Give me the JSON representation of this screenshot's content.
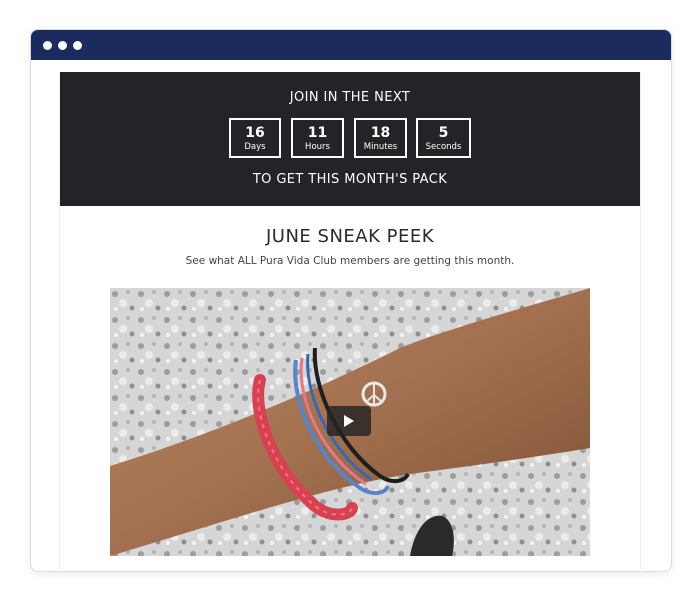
{
  "countdown": {
    "heading": "JOIN IN THE NEXT",
    "units": [
      {
        "value": "16",
        "label": "Days"
      },
      {
        "value": "11",
        "label": "Hours"
      },
      {
        "value": "18",
        "label": "Minutes"
      },
      {
        "value": "5",
        "label": "Seconds"
      }
    ],
    "footer": "TO GET THIS MONTH'S PACK"
  },
  "sneak_peek": {
    "title": "JUNE SNEAK PEEK",
    "subtitle": "See what ALL Pura Vida Club members are getting this month."
  },
  "video": {
    "play_icon": "play-icon"
  },
  "colors": {
    "titlebar": "#1b2b5e",
    "banner": "#232427",
    "accent_red": "#d8414f"
  }
}
